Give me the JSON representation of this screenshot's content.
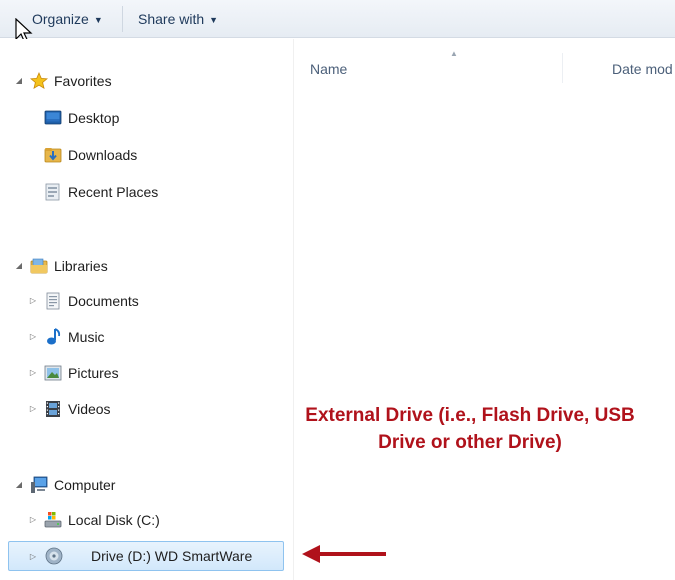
{
  "toolbar": {
    "organize_label": "Organize",
    "share_label": "Share with"
  },
  "nav": {
    "favorites": {
      "label": "Favorites",
      "items": [
        {
          "label": "Desktop",
          "icon": "desktop-icon"
        },
        {
          "label": "Downloads",
          "icon": "downloads-folder-icon"
        },
        {
          "label": "Recent Places",
          "icon": "recent-places-icon"
        }
      ]
    },
    "libraries": {
      "label": "Libraries",
      "items": [
        {
          "label": "Documents",
          "icon": "documents-icon"
        },
        {
          "label": "Music",
          "icon": "music-icon"
        },
        {
          "label": "Pictures",
          "icon": "pictures-icon"
        },
        {
          "label": "Videos",
          "icon": "videos-icon"
        }
      ]
    },
    "computer": {
      "label": "Computer",
      "items": [
        {
          "label": "Local Disk (C:)",
          "icon": "local-disk-icon"
        },
        {
          "label": "Drive (D:) WD SmartWare",
          "icon": "external-drive-icon",
          "selected": true
        }
      ]
    }
  },
  "columns": {
    "name": "Name",
    "date": "Date mod"
  },
  "annotation": {
    "line1": "External Drive (i.e., Flash Drive, USB",
    "line2": "Drive or other Drive)",
    "color": "#b0121b"
  }
}
